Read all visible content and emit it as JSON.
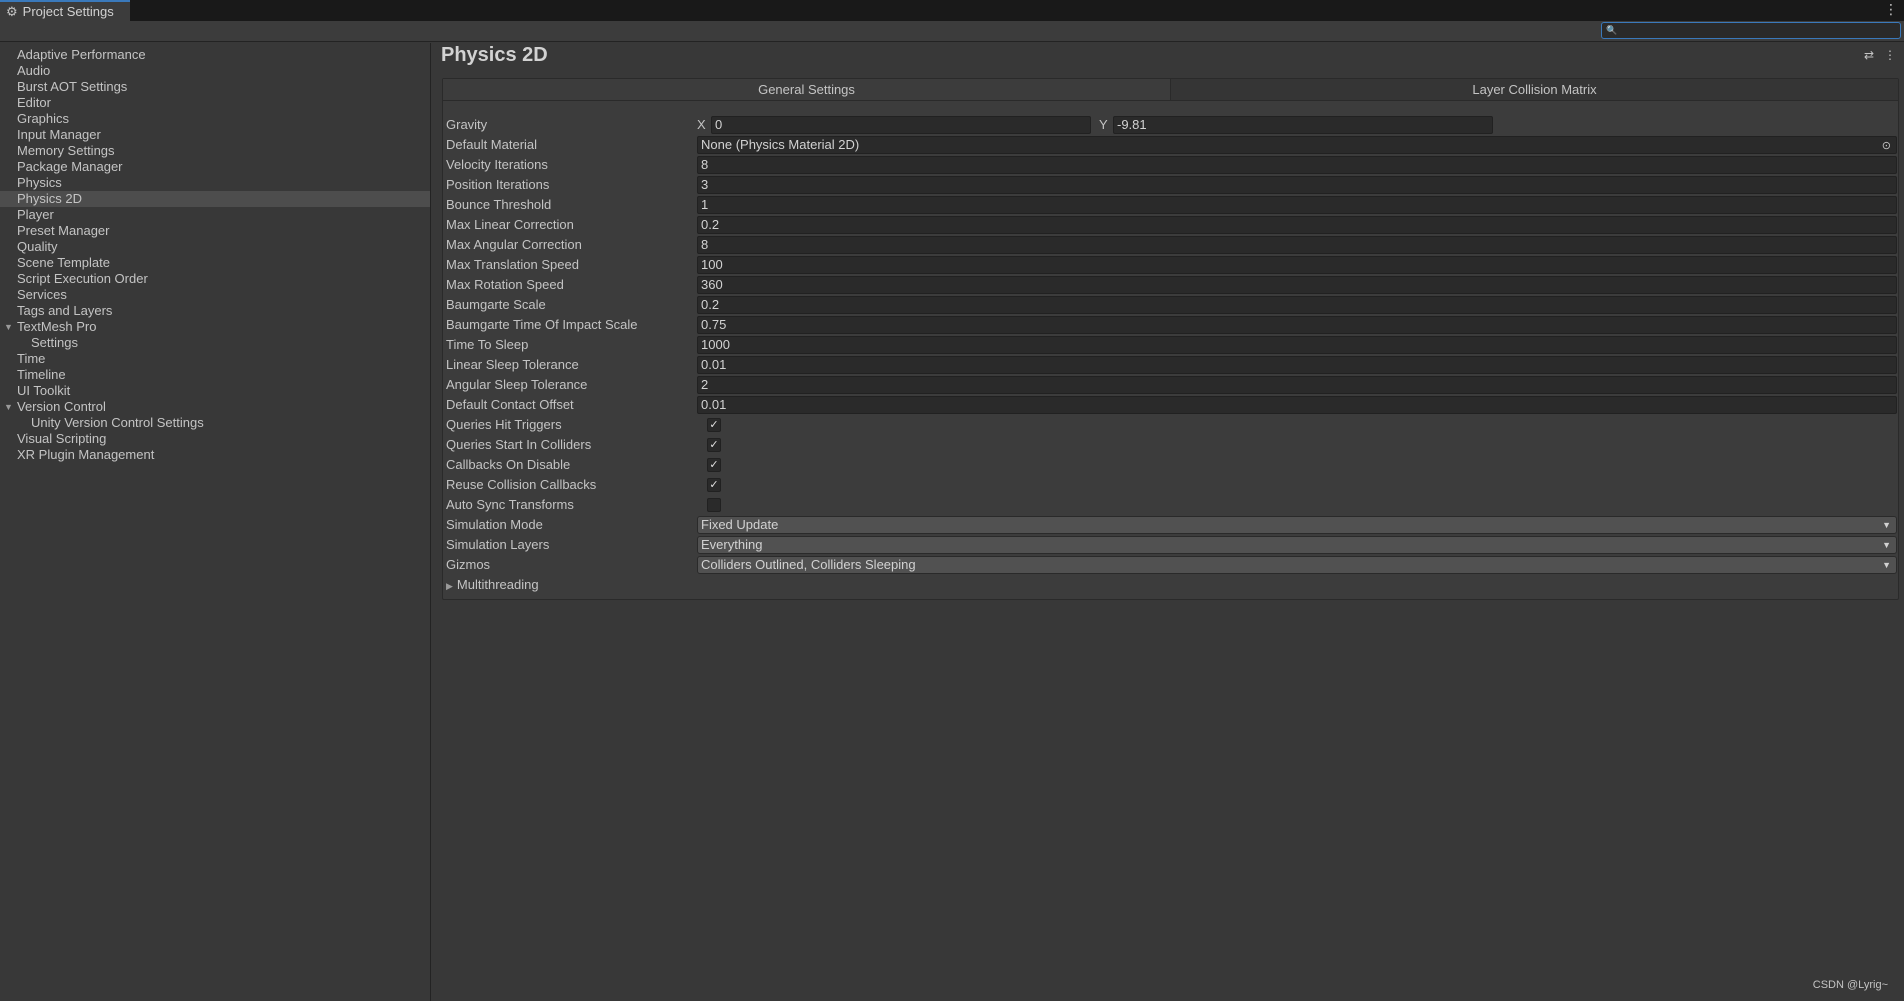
{
  "window": {
    "tab_title": "Project Settings",
    "search_value": "",
    "menu_glyph": "⋮"
  },
  "sidebar": {
    "items": [
      {
        "label": "Adaptive Performance"
      },
      {
        "label": "Audio"
      },
      {
        "label": "Burst AOT Settings"
      },
      {
        "label": "Editor"
      },
      {
        "label": "Graphics"
      },
      {
        "label": "Input Manager"
      },
      {
        "label": "Memory Settings"
      },
      {
        "label": "Package Manager"
      },
      {
        "label": "Physics"
      },
      {
        "label": "Physics 2D"
      },
      {
        "label": "Player"
      },
      {
        "label": "Preset Manager"
      },
      {
        "label": "Quality"
      },
      {
        "label": "Scene Template"
      },
      {
        "label": "Script Execution Order"
      },
      {
        "label": "Services"
      },
      {
        "label": "Tags and Layers"
      },
      {
        "label": "TextMesh Pro"
      },
      {
        "label": "Settings"
      },
      {
        "label": "Time"
      },
      {
        "label": "Timeline"
      },
      {
        "label": "UI Toolkit"
      },
      {
        "label": "Version Control"
      },
      {
        "label": "Unity Version Control Settings"
      },
      {
        "label": "Visual Scripting"
      },
      {
        "label": "XR Plugin Management"
      }
    ],
    "selected": "Physics 2D"
  },
  "main": {
    "title": "Physics 2D",
    "tabs": [
      {
        "label": "General Settings"
      },
      {
        "label": "Layer Collision Matrix"
      }
    ],
    "gravity": {
      "label": "Gravity",
      "x_label": "X",
      "x": "0",
      "y_label": "Y",
      "y": "-9.81"
    },
    "default_material": {
      "label": "Default Material",
      "value": "None (Physics Material 2D)"
    },
    "fields": [
      {
        "label": "Velocity Iterations",
        "value": "8"
      },
      {
        "label": "Position Iterations",
        "value": "3"
      },
      {
        "label": "Bounce Threshold",
        "value": "1"
      },
      {
        "label": "Max Linear Correction",
        "value": "0.2"
      },
      {
        "label": "Max Angular Correction",
        "value": "8"
      },
      {
        "label": "Max Translation Speed",
        "value": "100"
      },
      {
        "label": "Max Rotation Speed",
        "value": "360"
      },
      {
        "label": "Baumgarte Scale",
        "value": "0.2"
      },
      {
        "label": "Baumgarte Time Of Impact Scale",
        "value": "0.75"
      },
      {
        "label": "Time To Sleep",
        "value": "1000"
      },
      {
        "label": "Linear Sleep Tolerance",
        "value": "0.01"
      },
      {
        "label": "Angular Sleep Tolerance",
        "value": "2"
      },
      {
        "label": "Default Contact Offset",
        "value": "0.01"
      }
    ],
    "checkboxes": [
      {
        "label": "Queries Hit Triggers",
        "checked": true
      },
      {
        "label": "Queries Start In Colliders",
        "checked": true
      },
      {
        "label": "Callbacks On Disable",
        "checked": true
      },
      {
        "label": "Reuse Collision Callbacks",
        "checked": true
      },
      {
        "label": "Auto Sync Transforms",
        "checked": false
      }
    ],
    "dropdowns": [
      {
        "label": "Simulation Mode",
        "value": "Fixed Update"
      },
      {
        "label": "Simulation Layers",
        "value": "Everything"
      },
      {
        "label": "Gizmos",
        "value": "Colliders Outlined, Colliders Sleeping"
      }
    ],
    "foldout": {
      "label": "Multithreading"
    }
  },
  "watermark": "CSDN @Lyrig~"
}
